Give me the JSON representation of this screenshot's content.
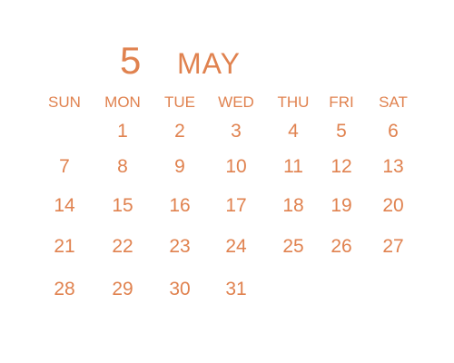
{
  "calendar": {
    "month_number": "5",
    "month_name": "MAY",
    "weekdays": [
      "SUN",
      "MON",
      "TUE",
      "WED",
      "THU",
      "FRI",
      "SAT"
    ],
    "weeks": [
      [
        "",
        "1",
        "2",
        "3",
        "4",
        "5",
        "6"
      ],
      [
        "7",
        "8",
        "9",
        "10",
        "11",
        "12",
        "13"
      ],
      [
        "14",
        "15",
        "16",
        "17",
        "18",
        "19",
        "20"
      ],
      [
        "21",
        "22",
        "23",
        "24",
        "25",
        "26",
        "27"
      ],
      [
        "28",
        "29",
        "30",
        "31",
        "",
        "",
        ""
      ]
    ]
  },
  "colors": {
    "accent": "#E0824F",
    "background": "#FFFFFF"
  }
}
